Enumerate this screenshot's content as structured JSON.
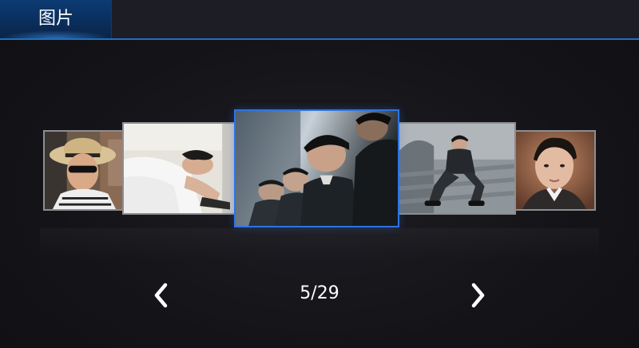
{
  "header": {
    "title": "图片"
  },
  "gallery": {
    "counter": "5/29",
    "current_index": 5,
    "total": 29,
    "thumbnails": [
      {
        "name": "photo-man-straw-hat",
        "selected": false
      },
      {
        "name": "photo-man-lying-white-shirt",
        "selected": false
      },
      {
        "name": "photo-group-men-dark",
        "selected": true
      },
      {
        "name": "photo-man-sitting-steps",
        "selected": false
      },
      {
        "name": "photo-man-portrait",
        "selected": false
      }
    ]
  },
  "controls": {
    "prev_icon": "chevron-left-icon",
    "next_icon": "chevron-right-icon"
  },
  "colors": {
    "accent": "#2f73e6",
    "header_bg": "#1d1d26",
    "tab_bg": "#0a2f5e",
    "background": "#141418",
    "text": "#ffffff"
  }
}
